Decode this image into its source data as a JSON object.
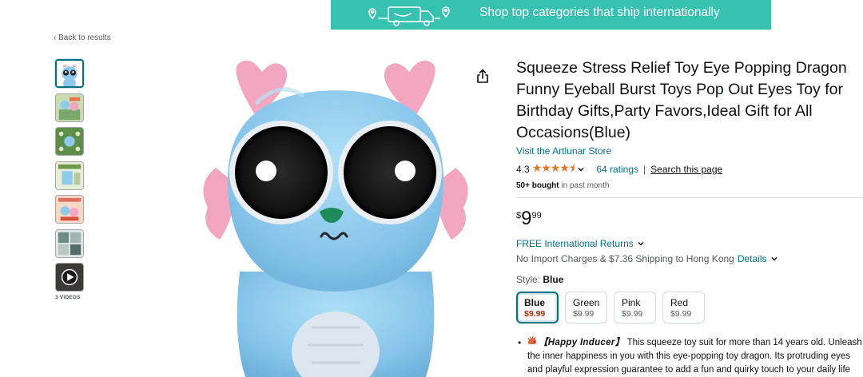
{
  "banner": {
    "text": "Shop top categories that ship internationally",
    "color": "#37c2b0"
  },
  "nav": {
    "back_label": "‹ Back to results"
  },
  "gallery": {
    "thumbnail_count": 7,
    "selected_index": 0,
    "videos_label": "3 VIDEOS"
  },
  "product": {
    "title": "Squeeze Stress Relief Toy Eye Popping Dragon Funny Eyeball Burst Toys Pop Out Eyes Toy for Birthday Gifts,Party Favors,Ideal Gift for All Occasions(Blue)",
    "store_link": "Visit the Artlunar Store",
    "rating_value": "4.3",
    "stars": "★★★★⯨",
    "ratings_count": "64 ratings",
    "separator": "|",
    "search_link": "Search this page",
    "bought_bold": "50+ bought",
    "bought_rest": " in past month"
  },
  "price": {
    "symbol": "$",
    "whole": "9",
    "fraction": "99"
  },
  "delivery": {
    "returns": "FREE International Returns",
    "shipping": "No Import Charges & $7.36 Shipping to Hong Kong",
    "details": "Details"
  },
  "style": {
    "label": "Style: ",
    "selected": "Blue",
    "options": [
      {
        "name": "Blue",
        "price": "$9.99"
      },
      {
        "name": "Green",
        "price": "$9.99"
      },
      {
        "name": "Pink",
        "price": "$9.99"
      },
      {
        "name": "Red",
        "price": "$9.99"
      }
    ]
  },
  "bullets": [
    {
      "heading": "【Happy Inducer】",
      "text": "This squeeze toy suit for more than 14 years old. Unleash the inner happiness in you with this eye-popping toy dragon. Its protruding eyes and playful expression guarantee to add a fun and quirky touch to your daily life that will make you smile."
    }
  ],
  "icons": {
    "share": "share-icon",
    "chevron": "chevron-down-icon",
    "play": "play-icon",
    "truck": "delivery-truck-icon"
  },
  "colors": {
    "link": "#007185",
    "star": "#de7921",
    "deal_price": "#b12704",
    "dragon_body": "#8fc9ec",
    "horn_pink": "#f2a6bf"
  }
}
